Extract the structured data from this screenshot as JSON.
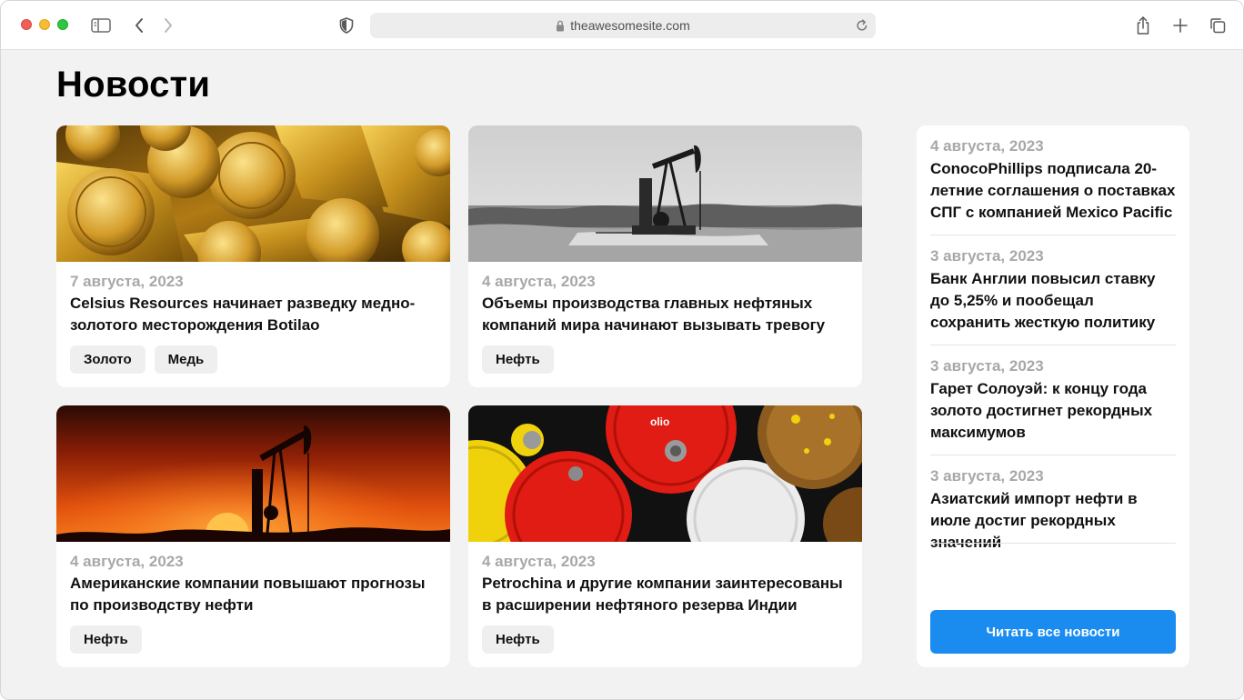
{
  "browser": {
    "url": "theawesomesite.com"
  },
  "page": {
    "title": "Новости"
  },
  "cards": [
    {
      "date": "7 августа, 2023",
      "headline": "Celsius Resources начинает разведку медно-золотого месторождения Botilao",
      "image": "gold-bars-and-coins",
      "tags": [
        "Золото",
        "Медь"
      ]
    },
    {
      "date": "4 августа, 2023",
      "headline": "Объемы производства главных нефтяных компаний мира начинают вызывать тревогу",
      "image": "oil-pump-jack-grayscale",
      "tags": [
        "Нефть"
      ]
    },
    {
      "date": "4 августа, 2023",
      "headline": "Американские компании повышают прогнозы по производству нефти",
      "image": "oil-pump-jack-sunset",
      "tags": [
        "Нефть"
      ]
    },
    {
      "date": "4 августа, 2023",
      "headline": "Petrochina и другие компании заинтересованы в расширении нефтяного резерва Индии",
      "image": "oil-barrels-top-view",
      "tags": [
        "Нефть"
      ]
    }
  ],
  "sidebar": {
    "items": [
      {
        "date": "4 августа, 2023",
        "title": "ConocoPhillips подписала 20-летние соглашения о поставках СПГ с компанией Mexico Pacific"
      },
      {
        "date": "3 августа, 2023",
        "title": "Банк Англии повысил ставку до 5,25% и пообещал сохранить жесткую политику"
      },
      {
        "date": "3 августа, 2023",
        "title": "Гарет Солоуэй: к концу года золото достигнет рекордных максимумов"
      },
      {
        "date": "3 августа, 2023",
        "title": "Азиатский импорт нефти в июле достиг рекордных значений"
      }
    ],
    "read_all_label": "Читать все новости"
  },
  "colors": {
    "accent": "#1a8cf0",
    "page_background": "#f2f2f2",
    "date_gray": "#a8a8a8"
  }
}
